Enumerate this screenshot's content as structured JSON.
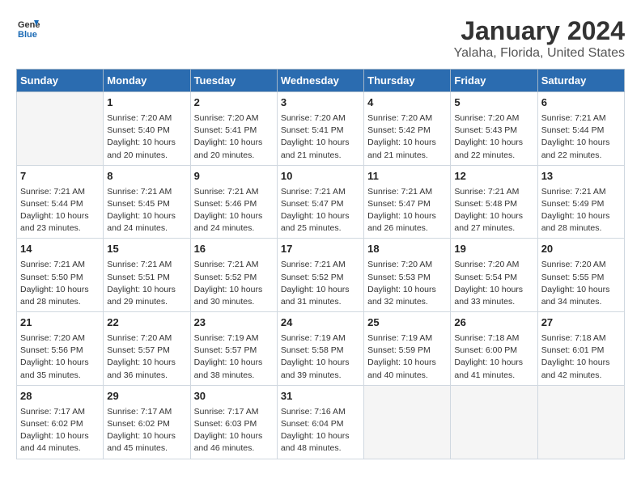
{
  "logo": {
    "general": "General",
    "blue": "Blue"
  },
  "title": "January 2024",
  "subtitle": "Yalaha, Florida, United States",
  "days_of_week": [
    "Sunday",
    "Monday",
    "Tuesday",
    "Wednesday",
    "Thursday",
    "Friday",
    "Saturday"
  ],
  "weeks": [
    [
      {
        "day": "",
        "info": ""
      },
      {
        "day": "1",
        "info": "Sunrise: 7:20 AM\nSunset: 5:40 PM\nDaylight: 10 hours\nand 20 minutes."
      },
      {
        "day": "2",
        "info": "Sunrise: 7:20 AM\nSunset: 5:41 PM\nDaylight: 10 hours\nand 20 minutes."
      },
      {
        "day": "3",
        "info": "Sunrise: 7:20 AM\nSunset: 5:41 PM\nDaylight: 10 hours\nand 21 minutes."
      },
      {
        "day": "4",
        "info": "Sunrise: 7:20 AM\nSunset: 5:42 PM\nDaylight: 10 hours\nand 21 minutes."
      },
      {
        "day": "5",
        "info": "Sunrise: 7:20 AM\nSunset: 5:43 PM\nDaylight: 10 hours\nand 22 minutes."
      },
      {
        "day": "6",
        "info": "Sunrise: 7:21 AM\nSunset: 5:44 PM\nDaylight: 10 hours\nand 22 minutes."
      }
    ],
    [
      {
        "day": "7",
        "info": "Sunrise: 7:21 AM\nSunset: 5:44 PM\nDaylight: 10 hours\nand 23 minutes."
      },
      {
        "day": "8",
        "info": "Sunrise: 7:21 AM\nSunset: 5:45 PM\nDaylight: 10 hours\nand 24 minutes."
      },
      {
        "day": "9",
        "info": "Sunrise: 7:21 AM\nSunset: 5:46 PM\nDaylight: 10 hours\nand 24 minutes."
      },
      {
        "day": "10",
        "info": "Sunrise: 7:21 AM\nSunset: 5:47 PM\nDaylight: 10 hours\nand 25 minutes."
      },
      {
        "day": "11",
        "info": "Sunrise: 7:21 AM\nSunset: 5:47 PM\nDaylight: 10 hours\nand 26 minutes."
      },
      {
        "day": "12",
        "info": "Sunrise: 7:21 AM\nSunset: 5:48 PM\nDaylight: 10 hours\nand 27 minutes."
      },
      {
        "day": "13",
        "info": "Sunrise: 7:21 AM\nSunset: 5:49 PM\nDaylight: 10 hours\nand 28 minutes."
      }
    ],
    [
      {
        "day": "14",
        "info": "Sunrise: 7:21 AM\nSunset: 5:50 PM\nDaylight: 10 hours\nand 28 minutes."
      },
      {
        "day": "15",
        "info": "Sunrise: 7:21 AM\nSunset: 5:51 PM\nDaylight: 10 hours\nand 29 minutes."
      },
      {
        "day": "16",
        "info": "Sunrise: 7:21 AM\nSunset: 5:52 PM\nDaylight: 10 hours\nand 30 minutes."
      },
      {
        "day": "17",
        "info": "Sunrise: 7:21 AM\nSunset: 5:52 PM\nDaylight: 10 hours\nand 31 minutes."
      },
      {
        "day": "18",
        "info": "Sunrise: 7:20 AM\nSunset: 5:53 PM\nDaylight: 10 hours\nand 32 minutes."
      },
      {
        "day": "19",
        "info": "Sunrise: 7:20 AM\nSunset: 5:54 PM\nDaylight: 10 hours\nand 33 minutes."
      },
      {
        "day": "20",
        "info": "Sunrise: 7:20 AM\nSunset: 5:55 PM\nDaylight: 10 hours\nand 34 minutes."
      }
    ],
    [
      {
        "day": "21",
        "info": "Sunrise: 7:20 AM\nSunset: 5:56 PM\nDaylight: 10 hours\nand 35 minutes."
      },
      {
        "day": "22",
        "info": "Sunrise: 7:20 AM\nSunset: 5:57 PM\nDaylight: 10 hours\nand 36 minutes."
      },
      {
        "day": "23",
        "info": "Sunrise: 7:19 AM\nSunset: 5:57 PM\nDaylight: 10 hours\nand 38 minutes."
      },
      {
        "day": "24",
        "info": "Sunrise: 7:19 AM\nSunset: 5:58 PM\nDaylight: 10 hours\nand 39 minutes."
      },
      {
        "day": "25",
        "info": "Sunrise: 7:19 AM\nSunset: 5:59 PM\nDaylight: 10 hours\nand 40 minutes."
      },
      {
        "day": "26",
        "info": "Sunrise: 7:18 AM\nSunset: 6:00 PM\nDaylight: 10 hours\nand 41 minutes."
      },
      {
        "day": "27",
        "info": "Sunrise: 7:18 AM\nSunset: 6:01 PM\nDaylight: 10 hours\nand 42 minutes."
      }
    ],
    [
      {
        "day": "28",
        "info": "Sunrise: 7:17 AM\nSunset: 6:02 PM\nDaylight: 10 hours\nand 44 minutes."
      },
      {
        "day": "29",
        "info": "Sunrise: 7:17 AM\nSunset: 6:02 PM\nDaylight: 10 hours\nand 45 minutes."
      },
      {
        "day": "30",
        "info": "Sunrise: 7:17 AM\nSunset: 6:03 PM\nDaylight: 10 hours\nand 46 minutes."
      },
      {
        "day": "31",
        "info": "Sunrise: 7:16 AM\nSunset: 6:04 PM\nDaylight: 10 hours\nand 48 minutes."
      },
      {
        "day": "",
        "info": ""
      },
      {
        "day": "",
        "info": ""
      },
      {
        "day": "",
        "info": ""
      }
    ]
  ]
}
